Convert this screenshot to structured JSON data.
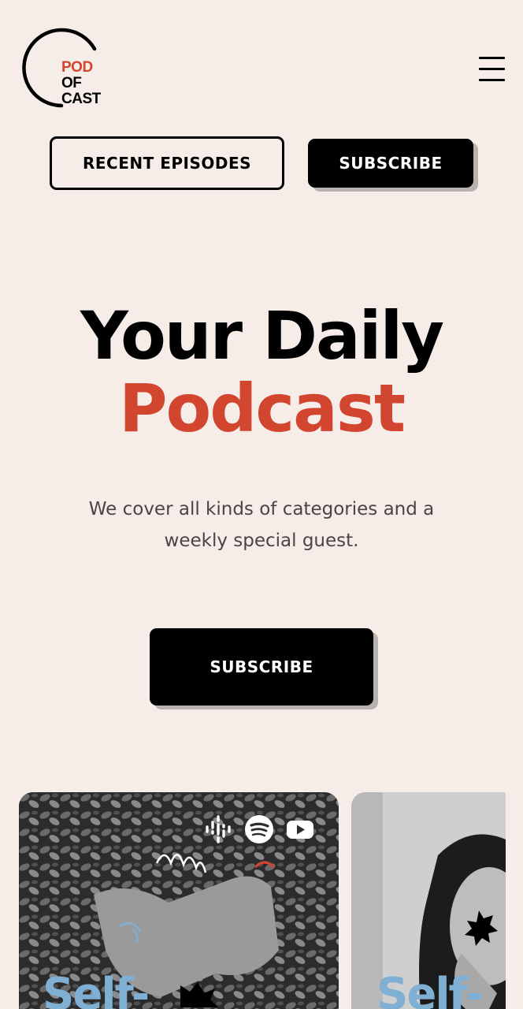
{
  "logo": {
    "line1": "POD",
    "line2": "OF",
    "line3": "CAST"
  },
  "header": {
    "recent_label": "RECENT EPISODES",
    "subscribe_label": "SUBSCRIBE"
  },
  "hero": {
    "title_line1": "Your Daily",
    "title_line2": "Podcast",
    "description": "We cover all kinds of categories and a weekly special guest.",
    "cta_label": "SUBSCRIBE"
  },
  "cards": [
    {
      "title": "Self-",
      "platforms": [
        "google-podcasts-icon",
        "spotify-icon",
        "youtube-icon"
      ]
    },
    {
      "title": "Self-"
    }
  ],
  "colors": {
    "background": "#f6ece8",
    "accent": "#d2452f",
    "card_title": "#7fb0d3"
  }
}
